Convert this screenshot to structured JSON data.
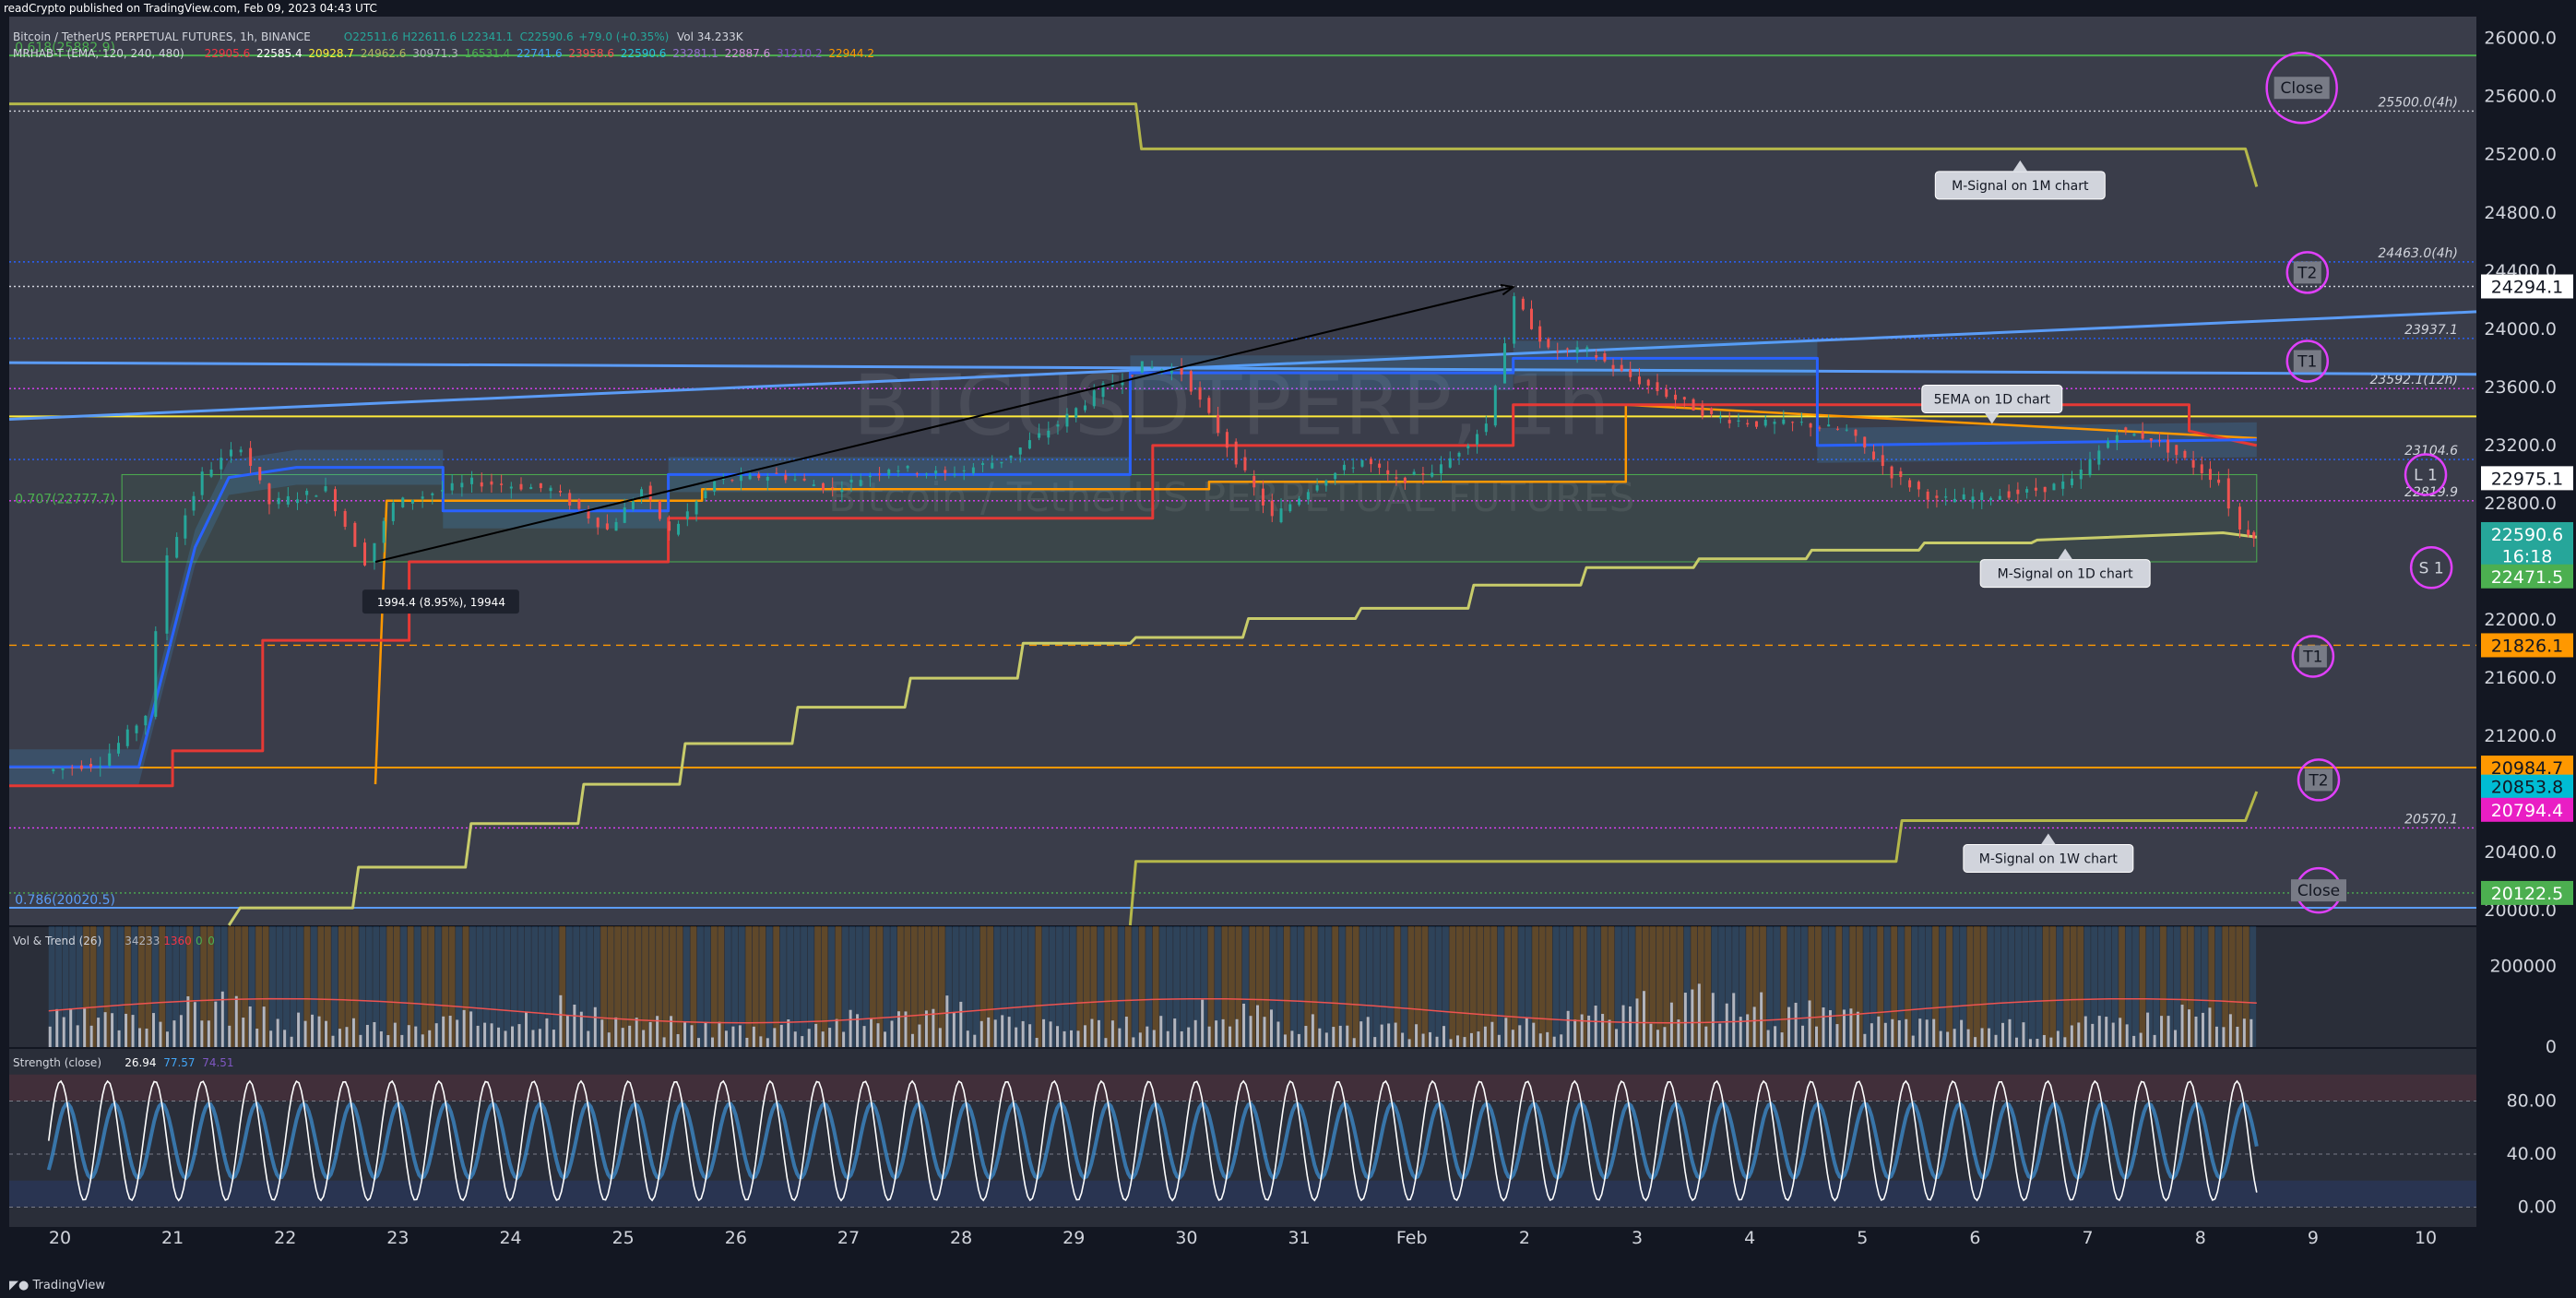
{
  "header": {
    "publisher": "readCrypto published on TradingView.com, Feb 09, 2023 04:43 UTC"
  },
  "footer": {
    "brand": "TradingView"
  },
  "legend": {
    "symbol_line": "Bitcoin / TetherUS PERPETUAL FUTURES, 1h, BINANCE",
    "ohlc": {
      "O": "O22511.6",
      "H": "H22611.6",
      "L": "L22341.1",
      "C": "C22590.6",
      "change": "+79.0 (+0.35%)",
      "vol": "Vol 34.233K"
    },
    "indicator_line": "MRHAB-T (EMA, 120, 240, 480)",
    "indicator_values": [
      {
        "v": "22905.6",
        "c": "#f23645"
      },
      {
        "v": "22585.4",
        "c": "#ffffff"
      },
      {
        "v": "20928.7",
        "c": "#ffeb3b"
      },
      {
        "v": "24962.6",
        "c": "#b2b561"
      },
      {
        "v": "30971.3",
        "c": "#b2b5be"
      },
      {
        "v": "16531.4",
        "c": "#4caf50"
      },
      {
        "v": "22741.6",
        "c": "#42a5f5"
      },
      {
        "v": "23958.6",
        "c": "#ef5350"
      },
      {
        "v": "22590.6",
        "c": "#26c6da"
      },
      {
        "v": "23281.1",
        "c": "#9575cd"
      },
      {
        "v": "22887.6",
        "c": "#ce93d8"
      },
      {
        "v": "31210.2",
        "c": "#7e57c2"
      },
      {
        "v": "22944.2",
        "c": "#ff9800"
      }
    ],
    "vol_trend": "Vol & Trend (26)",
    "vol_trend_values": [
      {
        "v": "34233",
        "c": "#b2b5be"
      },
      {
        "v": "1360",
        "c": "#f23645"
      },
      {
        "v": "0",
        "c": "#4caf50"
      },
      {
        "v": "0",
        "c": "#4caf50"
      }
    ],
    "strength": "Strength (close)",
    "strength_values": [
      {
        "v": "26.94",
        "c": "#ffffff"
      },
      {
        "v": "77.57",
        "c": "#42a5f5"
      },
      {
        "v": "74.51",
        "c": "#7e57c2"
      }
    ]
  },
  "watermark": {
    "ticker": "BTCUSDTPERP, 1h",
    "name": "Bitcoin / TetherUS PERPETUAL FUTURES"
  },
  "colors": {
    "background": "#131722",
    "main_pane": "#3a3d4a",
    "sub_pane": "#2a2e39",
    "axis_text": "#d1d4dc",
    "olive": "#b5b84a",
    "blue": "#2962ff",
    "red": "#e53935",
    "orange": "#ff9800",
    "light_blue": "#5b9cf6",
    "magenta": "#e040fb",
    "green": "#4caf50",
    "yellow": "#ffeb3b"
  },
  "chart_data": [
    {
      "type": "line",
      "pane": "price",
      "title": "Bitcoin / TetherUS PERPETUAL FUTURES, 1h, BINANCE",
      "ylim": [
        19900,
        26150
      ],
      "y_ticks": [
        20000,
        20400,
        20800,
        21200,
        21600,
        22000,
        22400,
        22800,
        23200,
        23600,
        24000,
        24400,
        24800,
        25200,
        25600,
        26000
      ],
      "x_ticks": [
        "20",
        "21",
        "22",
        "23",
        "24",
        "25",
        "26",
        "27",
        "28",
        "29",
        "30",
        "31",
        "Feb",
        "2",
        "3",
        "4",
        "5",
        "6",
        "7",
        "8",
        "9",
        "10"
      ],
      "x_range_days": [
        -0.35,
        21.55
      ],
      "price_series_close": [
        {
          "x": 0,
          "y": 20960
        },
        {
          "x": 0.5,
          "y": 21020
        },
        {
          "x": 0.9,
          "y": 21350
        },
        {
          "x": 1.1,
          "y": 22450
        },
        {
          "x": 1.4,
          "y": 23000
        },
        {
          "x": 1.75,
          "y": 23200
        },
        {
          "x": 2.0,
          "y": 22800
        },
        {
          "x": 2.5,
          "y": 22900
        },
        {
          "x": 2.85,
          "y": 22400
        },
        {
          "x": 3.1,
          "y": 22800
        },
        {
          "x": 3.8,
          "y": 22950
        },
        {
          "x": 4.5,
          "y": 22900
        },
        {
          "x": 5.0,
          "y": 22620
        },
        {
          "x": 5.3,
          "y": 22900
        },
        {
          "x": 5.55,
          "y": 22600
        },
        {
          "x": 5.95,
          "y": 22950
        },
        {
          "x": 6.5,
          "y": 23000
        },
        {
          "x": 7.0,
          "y": 22900
        },
        {
          "x": 7.5,
          "y": 23050
        },
        {
          "x": 8.0,
          "y": 23000
        },
        {
          "x": 8.5,
          "y": 23100
        },
        {
          "x": 9.0,
          "y": 23350
        },
        {
          "x": 9.4,
          "y": 23600
        },
        {
          "x": 9.75,
          "y": 23750
        },
        {
          "x": 10.1,
          "y": 23700
        },
        {
          "x": 10.5,
          "y": 23200
        },
        {
          "x": 10.9,
          "y": 22700
        },
        {
          "x": 11.3,
          "y": 22950
        },
        {
          "x": 11.7,
          "y": 23100
        },
        {
          "x": 12.0,
          "y": 22950
        },
        {
          "x": 12.4,
          "y": 23050
        },
        {
          "x": 12.8,
          "y": 23350
        },
        {
          "x": 13.05,
          "y": 24200
        },
        {
          "x": 13.35,
          "y": 23850
        },
        {
          "x": 13.7,
          "y": 23850
        },
        {
          "x": 14.0,
          "y": 23700
        },
        {
          "x": 14.4,
          "y": 23550
        },
        {
          "x": 14.8,
          "y": 23400
        },
        {
          "x": 15.2,
          "y": 23350
        },
        {
          "x": 15.6,
          "y": 23350
        },
        {
          "x": 16.0,
          "y": 23300
        },
        {
          "x": 16.4,
          "y": 23000
        },
        {
          "x": 16.8,
          "y": 22820
        },
        {
          "x": 17.2,
          "y": 22850
        },
        {
          "x": 17.6,
          "y": 22880
        },
        {
          "x": 18.0,
          "y": 22950
        },
        {
          "x": 18.4,
          "y": 23300
        },
        {
          "x": 18.7,
          "y": 23250
        },
        {
          "x": 19.0,
          "y": 23100
        },
        {
          "x": 19.3,
          "y": 22950
        },
        {
          "x": 19.5,
          "y": 22620
        },
        {
          "x": 19.6,
          "y": 22590
        }
      ],
      "ema_red": [
        {
          "x": -0.35,
          "y": 20860
        },
        {
          "x": 1.1,
          "y": 20860
        },
        {
          "x": 1.1,
          "y": 21100
        },
        {
          "x": 1.9,
          "y": 21100
        },
        {
          "x": 1.9,
          "y": 21860
        },
        {
          "x": 3.2,
          "y": 21860
        },
        {
          "x": 3.2,
          "y": 22400
        },
        {
          "x": 5.5,
          "y": 22400
        },
        {
          "x": 5.5,
          "y": 22700
        },
        {
          "x": 9.8,
          "y": 22700
        },
        {
          "x": 9.8,
          "y": 23200
        },
        {
          "x": 13.0,
          "y": 23200
        },
        {
          "x": 13.0,
          "y": 23480
        },
        {
          "x": 19.0,
          "y": 23480
        },
        {
          "x": 19.0,
          "y": 23300
        },
        {
          "x": 19.6,
          "y": 23200
        }
      ],
      "ema_blue": [
        {
          "x": -0.35,
          "y": 20990
        },
        {
          "x": 0.8,
          "y": 20990
        },
        {
          "x": 1.3,
          "y": 22500
        },
        {
          "x": 1.6,
          "y": 22980
        },
        {
          "x": 2.2,
          "y": 23050
        },
        {
          "x": 3.5,
          "y": 23050
        },
        {
          "x": 3.5,
          "y": 22750
        },
        {
          "x": 5.5,
          "y": 22750
        },
        {
          "x": 5.5,
          "y": 23000
        },
        {
          "x": 9.6,
          "y": 23000
        },
        {
          "x": 9.6,
          "y": 23700
        },
        {
          "x": 13.0,
          "y": 23700
        },
        {
          "x": 13.0,
          "y": 23800
        },
        {
          "x": 15.7,
          "y": 23800
        },
        {
          "x": 15.7,
          "y": 23200
        },
        {
          "x": 19.6,
          "y": 23240
        }
      ],
      "ema_orange": [
        {
          "x": 2.9,
          "y": 20870
        },
        {
          "x": 3.0,
          "y": 22820
        },
        {
          "x": 5.8,
          "y": 22820
        },
        {
          "x": 5.8,
          "y": 22900
        },
        {
          "x": 10.3,
          "y": 22900
        },
        {
          "x": 10.3,
          "y": 22950
        },
        {
          "x": 14.0,
          "y": 22950
        },
        {
          "x": 14.0,
          "y": 23480
        },
        {
          "x": 19.6,
          "y": 23250
        }
      ],
      "m_signal_1m": [
        {
          "x": -0.35,
          "y": 25550
        },
        {
          "x": 9.65,
          "y": 25550
        },
        {
          "x": 9.7,
          "y": 25240
        },
        {
          "x": 19.5,
          "y": 25240
        },
        {
          "x": 19.6,
          "y": 24980
        }
      ],
      "m_signal_1w": [
        {
          "x": 9.6,
          "y": 19900
        },
        {
          "x": 9.65,
          "y": 20340
        },
        {
          "x": 16.4,
          "y": 20340
        },
        {
          "x": 16.45,
          "y": 20620
        },
        {
          "x": 19.5,
          "y": 20620
        },
        {
          "x": 19.6,
          "y": 20820
        }
      ],
      "m_signal_1d_steps": [
        {
          "x": 1.6,
          "y": 19900
        },
        {
          "x": 1.7,
          "y": 20020
        },
        {
          "x": 2.7,
          "y": 20020
        },
        {
          "x": 2.75,
          "y": 20300
        },
        {
          "x": 3.7,
          "y": 20300
        },
        {
          "x": 3.75,
          "y": 20600
        },
        {
          "x": 4.7,
          "y": 20600
        },
        {
          "x": 4.75,
          "y": 20870
        },
        {
          "x": 5.6,
          "y": 20870
        },
        {
          "x": 5.65,
          "y": 21150
        },
        {
          "x": 6.6,
          "y": 21150
        },
        {
          "x": 6.65,
          "y": 21400
        },
        {
          "x": 7.6,
          "y": 21400
        },
        {
          "x": 7.65,
          "y": 21600
        },
        {
          "x": 8.6,
          "y": 21600
        },
        {
          "x": 8.65,
          "y": 21840
        },
        {
          "x": 9.6,
          "y": 21840
        },
        {
          "x": 9.65,
          "y": 21880
        },
        {
          "x": 10.6,
          "y": 21880
        },
        {
          "x": 10.65,
          "y": 22010
        },
        {
          "x": 11.6,
          "y": 22010
        },
        {
          "x": 11.65,
          "y": 22080
        },
        {
          "x": 12.6,
          "y": 22080
        },
        {
          "x": 12.65,
          "y": 22240
        },
        {
          "x": 13.6,
          "y": 22240
        },
        {
          "x": 13.65,
          "y": 22360
        },
        {
          "x": 14.6,
          "y": 22360
        },
        {
          "x": 14.65,
          "y": 22420
        },
        {
          "x": 15.6,
          "y": 22420
        },
        {
          "x": 15.65,
          "y": 22480
        },
        {
          "x": 16.6,
          "y": 22480
        },
        {
          "x": 16.65,
          "y": 22530
        },
        {
          "x": 17.6,
          "y": 22530
        },
        {
          "x": 17.65,
          "y": 22550
        },
        {
          "x": 19.3,
          "y": 22600
        },
        {
          "x": 19.6,
          "y": 22570
        }
      ],
      "horizontal_levels": [
        {
          "label": "25500.0(4h)",
          "y": 25500,
          "color": "#d1d4dc",
          "style": "dotted"
        },
        {
          "label": "24463.0(4h)",
          "y": 24463,
          "color": "#2962ff",
          "style": "dotted"
        },
        {
          "label": "23937.1",
          "y": 23937,
          "color": "#2962ff",
          "style": "dotted"
        },
        {
          "label": "23592.1(12h)",
          "y": 23592,
          "color": "#e040fb",
          "style": "dotted"
        },
        {
          "label": "23104.6",
          "y": 23104,
          "color": "#2962ff",
          "style": "dotted"
        },
        {
          "label": "22819.9",
          "y": 22820,
          "color": "#e040fb",
          "style": "dotted"
        },
        {
          "label": "20570.1",
          "y": 20570,
          "color": "#e040fb",
          "style": "dotted"
        },
        {
          "label": "",
          "y": 25882.9,
          "color": "#4caf50",
          "style": "solid"
        },
        {
          "label": "",
          "y": 23400,
          "color": "#ffeb3b",
          "style": "solid"
        },
        {
          "label": "",
          "y": 21826.1,
          "color": "#ff9800",
          "style": "dashed"
        },
        {
          "label": "",
          "y": 20984.7,
          "color": "#ff9800",
          "style": "solid"
        },
        {
          "label": "",
          "y": 20122.5,
          "color": "#4caf50",
          "style": "dotted"
        },
        {
          "label": "",
          "y": 20020.5,
          "color": "#5b9cf6",
          "style": "solid"
        },
        {
          "label": "",
          "y": 24294.1,
          "color": "#d1d4dc",
          "style": "dotted"
        }
      ],
      "fib_labels": [
        {
          "text": "0.618(25882.9)",
          "x": -0.3,
          "y": 25882.9,
          "color": "#4caf50"
        },
        {
          "text": "0.707(22777.7)",
          "x": -0.3,
          "y": 22777.7,
          "color": "#4caf50"
        },
        {
          "text": "0.786(20020.5)",
          "x": -0.3,
          "y": 20020.5,
          "color": "#5b9cf6"
        }
      ],
      "price_labels": [
        {
          "text": "24294.1",
          "y": 24294.1,
          "bg": "#ffffff",
          "fg": "#131722"
        },
        {
          "text": "22975.1",
          "y": 22975.1,
          "bg": "#ffffff",
          "fg": "#131722"
        },
        {
          "text": "22590.6",
          "y": 22590.6,
          "bg": "#26a69a",
          "fg": "#ffffff"
        },
        {
          "text": "16:18",
          "y": 22440,
          "bg": "#26a69a",
          "fg": "#ffffff"
        },
        {
          "text": "22471.5",
          "y": 22300,
          "bg": "#4caf50",
          "fg": "#ffffff"
        },
        {
          "text": "21826.1",
          "y": 21826.1,
          "bg": "#ff9800",
          "fg": "#131722"
        },
        {
          "text": "20984.7",
          "y": 20984.7,
          "bg": "#ff9800",
          "fg": "#131722"
        },
        {
          "text": "20853.8",
          "y": 20853.8,
          "bg": "#00bcd4",
          "fg": "#131722"
        },
        {
          "text": "20794.4",
          "y": 20694.4,
          "bg": "#e91ec4",
          "fg": "#ffffff"
        },
        {
          "text": "20122.5",
          "y": 20122.5,
          "bg": "#4caf50",
          "fg": "#ffffff"
        }
      ],
      "circle_labels": [
        {
          "text": "Close",
          "x": 20.0,
          "y": 25660,
          "r": 38,
          "box": true
        },
        {
          "text": "T2",
          "x": 20.05,
          "y": 24390,
          "r": 22,
          "box": true
        },
        {
          "text": "T1",
          "x": 20.05,
          "y": 23780,
          "r": 22,
          "box": true
        },
        {
          "text": "L 1",
          "x": 21.1,
          "y": 23000,
          "r": 22,
          "box": false
        },
        {
          "text": "S 1",
          "x": 21.15,
          "y": 22360,
          "r": 22,
          "box": false
        },
        {
          "text": "T1",
          "x": 20.1,
          "y": 21750,
          "r": 22,
          "box": true
        },
        {
          "text": "T2",
          "x": 20.15,
          "y": 20900,
          "r": 22,
          "box": true
        },
        {
          "text": "Close",
          "x": 20.15,
          "y": 20140,
          "r": 24,
          "box": true
        }
      ],
      "callouts": [
        {
          "text": "M-Signal on 1M chart",
          "x": 17.5,
          "y": 24990,
          "pointer": "up"
        },
        {
          "text": "5EMA on 1D chart",
          "x": 17.25,
          "y": 23520,
          "pointer": "down"
        },
        {
          "text": "M-Signal on 1D chart",
          "x": 17.9,
          "y": 22320,
          "pointer": "up"
        },
        {
          "text": "M-Signal on 1W chart",
          "x": 17.75,
          "y": 20360,
          "pointer": "up"
        }
      ],
      "measure": {
        "text": "1994.4 (8.95%), 19944",
        "x": 2.85,
        "y": 22120
      },
      "trend_arrow": {
        "x1": 2.9,
        "y1": 22400,
        "x2": 13.0,
        "y2": 24290
      },
      "light_blue_lines": [
        {
          "x1": -0.35,
          "y1": 23380,
          "x2": 21.55,
          "y2": 24120
        },
        {
          "x1": -0.35,
          "y1": 23770,
          "x2": 21.55,
          "y2": 23690
        }
      ]
    },
    {
      "type": "bar",
      "pane": "volume",
      "title": "Vol & Trend (26)",
      "ylim": [
        0,
        300000
      ],
      "y_ticks": [
        0,
        200000
      ],
      "series": [
        {
          "name": "34233",
          "values": [
            90000,
            85000,
            120000,
            150000,
            95000,
            80000,
            70000,
            60000,
            85000,
            110000,
            140000,
            90000,
            75000,
            70000,
            65000,
            80000,
            90000,
            100000,
            120000,
            85000,
            70000,
            65000,
            75000,
            90000,
            110000,
            95000,
            80000,
            70000,
            60000,
            55000,
            70000,
            85000,
            100000,
            130000,
            160000,
            140000,
            110000,
            90000,
            80000,
            70000,
            65000,
            60000,
            75000,
            90000,
            120000,
            80000
          ]
        }
      ]
    },
    {
      "type": "line",
      "pane": "strength",
      "title": "Strength (close)",
      "ylim": [
        -15,
        120
      ],
      "y_ticks": [
        0,
        40,
        80
      ],
      "series": [
        {
          "name": "26.94",
          "period_days": 0.42,
          "amplitude": 45,
          "mid": 50
        }
      ]
    }
  ]
}
